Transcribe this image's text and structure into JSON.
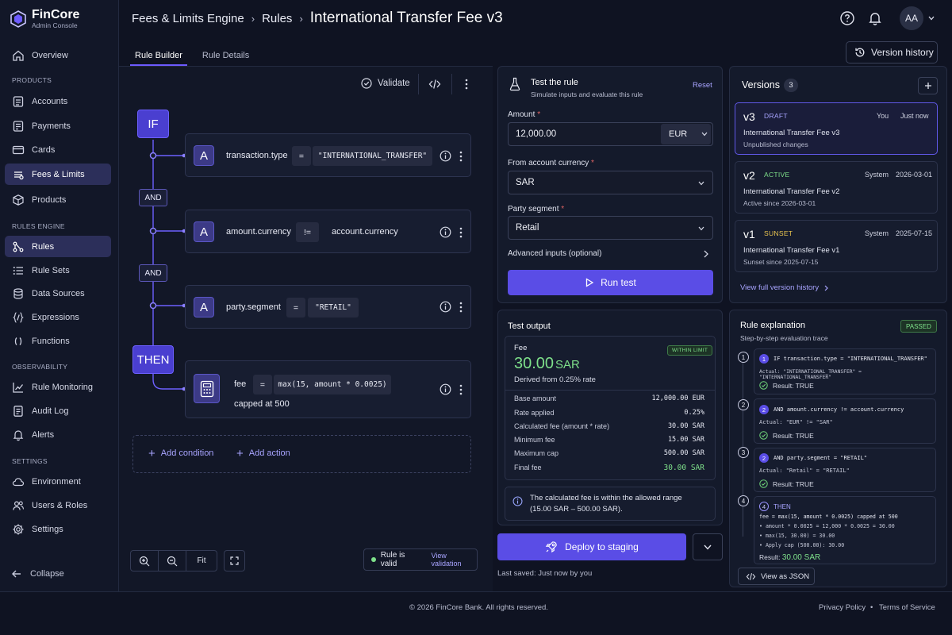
{
  "app": {
    "name": "FinCore",
    "subtitle": "Admin Console"
  },
  "sidebar": {
    "overview": "Overview",
    "sections": [
      {
        "label": "PRODUCTS",
        "items": [
          "Accounts",
          "Payments",
          "Cards",
          "Fees & Limits",
          "Products"
        ]
      },
      {
        "label": "RULES ENGINE",
        "items": [
          "Rules",
          "Rule Sets",
          "Data Sources",
          "Expressions",
          "Functions"
        ]
      },
      {
        "label": "OBSERVABILITY",
        "items": [
          "Rule Monitoring",
          "Audit Log",
          "Alerts"
        ]
      },
      {
        "label": "SETTINGS",
        "items": [
          "Environment",
          "Users & Roles",
          "Settings"
        ]
      }
    ],
    "collapse": "Collapse"
  },
  "header": {
    "breadcrumb": [
      "Fees & Limits Engine",
      "Rules",
      "International Transfer Fee v3"
    ],
    "avatar": "AA",
    "version_history": "Version history"
  },
  "tabs": [
    "Rule Builder",
    "Rule Details"
  ],
  "builder": {
    "validate": "Validate",
    "if": "IF",
    "and": "AND",
    "then": "THEN",
    "conditions": [
      {
        "badge": "A",
        "field": "transaction.type",
        "op": "=",
        "value": "\"INTERNATIONAL_TRANSFER\""
      },
      {
        "badge": "A",
        "field": "amount.currency",
        "op": "!=",
        "value": "account.currency"
      },
      {
        "badge": "A",
        "field": "party.segment",
        "op": "=",
        "value": "\"RETAIL\""
      }
    ],
    "action": {
      "field": "fee",
      "op": "=",
      "expr": "max(15, amount * 0.0025)",
      "note": "capped at 500"
    },
    "add_condition": "Add condition",
    "add_action": "Add action",
    "fit": "Fit",
    "valid_status": "Rule is valid",
    "view_validation": "View validation"
  },
  "test": {
    "title": "Test the rule",
    "subtitle": "Simulate inputs and evaluate this rule",
    "reset": "Reset",
    "amount_label": "Amount",
    "amount_value": "12,000.00",
    "amount_currency": "EUR",
    "from_label": "From account currency",
    "from_value": "SAR",
    "segment_label": "Party segment",
    "segment_value": "Retail",
    "advanced": "Advanced inputs (optional)",
    "run": "Run test"
  },
  "output": {
    "title": "Test output",
    "fee_label": "Fee",
    "fee_value": "30.00",
    "fee_currency": "SAR",
    "badge": "WITHIN LIMIT",
    "derived": "Derived from 0.25% rate",
    "rows": [
      {
        "k": "Base amount",
        "v": "12,000.00 EUR"
      },
      {
        "k": "Rate applied",
        "v": "0.25%"
      },
      {
        "k": "Calculated fee (amount * rate)",
        "v": "30.00 SAR"
      },
      {
        "k": "Minimum fee",
        "v": "15.00 SAR"
      },
      {
        "k": "Maximum cap",
        "v": "500.00 SAR"
      },
      {
        "k": "Final fee",
        "v": "30.00 SAR"
      }
    ],
    "note_line1": "The calculated fee is within the allowed range",
    "note_line2": "(15.00 SAR – 500.00 SAR)."
  },
  "deploy": {
    "label": "Deploy to staging",
    "last_saved": "Last saved: Just now by you"
  },
  "versions": {
    "title": "Versions",
    "count": "3",
    "items": [
      {
        "num": "v3",
        "status": "DRAFT",
        "by": "You",
        "when": "Just now",
        "title": "International Transfer Fee v3",
        "sub": "Unpublished changes"
      },
      {
        "num": "v2",
        "status": "ACTIVE",
        "by": "System",
        "when": "2026-03-01",
        "title": "International Transfer Fee v2",
        "sub": "Active since 2026-03-01"
      },
      {
        "num": "v1",
        "status": "SUNSET",
        "by": "System",
        "when": "2025-07-15",
        "title": "International Transfer Fee v1",
        "sub": "Sunset since 2025-07-15"
      }
    ],
    "view_all": "View full version history"
  },
  "explanation": {
    "title": "Rule explanation",
    "subtitle": "Step-by-step evaluation trace",
    "badge": "PASSED",
    "steps": [
      {
        "n": "1",
        "head": "IF transaction.type = \"INTERNATIONAL_TRANSFER\"",
        "actual": "Actual: \"INTERNATIONAL_TRANSFER\" = \"INTERNATIONAL_TRANSFER\"",
        "result": "Result: TRUE"
      },
      {
        "n": "2",
        "head": "AND amount.currency != account.currency",
        "actual": "Actual: \"EUR\" != \"SAR\"",
        "result": "Result: TRUE"
      },
      {
        "n": "2",
        "head": "AND party.segment = \"RETAIL\"",
        "actual": "Actual: \"Retail\" = \"RETAIL\"",
        "result": "Result: TRUE"
      }
    ],
    "then": {
      "n": "4",
      "head": "THEN",
      "lines": [
        "fee = max(15, amount * 0.0025) capped at 500",
        "• amount * 0.0025 = 12,000 * 0.0025 = 30.00",
        "• max(15, 30.00) = 30.00",
        "• Apply cap (500.00): 30.00"
      ],
      "result_label": "Result:",
      "result_value": "30.00 SAR"
    },
    "gutter": [
      "1",
      "2",
      "3",
      "4"
    ],
    "view_json": "View as JSON"
  },
  "footer": {
    "copyright": "© 2026 FinCore Bank. All rights reserved.",
    "privacy": "Privacy Policy",
    "terms": "Terms of Service"
  },
  "colors": {
    "accent": "#5a4de6",
    "active": "#7ee08a",
    "sunset": "#e8c34f",
    "passed": "#6fd37a"
  }
}
